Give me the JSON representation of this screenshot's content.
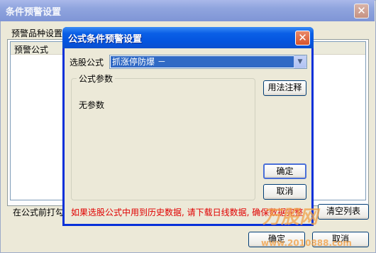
{
  "outer": {
    "title": "条件预警设置",
    "close_glyph": "✕",
    "tab_label": "预警品种设置",
    "list_header": "预警公式",
    "bottom_note": "在公式前打勾",
    "clear_button": "清空列表",
    "ok_button": "确定",
    "cancel_button": "取消"
  },
  "dialog": {
    "title": "公式条件预警设置",
    "close_glyph": "✕",
    "formula_label": "选股公式",
    "formula_value": "抓涨停防爆    －",
    "params_group_title": "公式参数",
    "no_params_text": "无参数",
    "usage_button": "用法注释",
    "ok_button": "确定",
    "cancel_button": "取消",
    "warning": "如果选股公式中用到历史数据, 请下载日线数据, 确保数据完整"
  },
  "watermark": {
    "main": "万股网",
    "url": "www.2010888.com"
  }
}
